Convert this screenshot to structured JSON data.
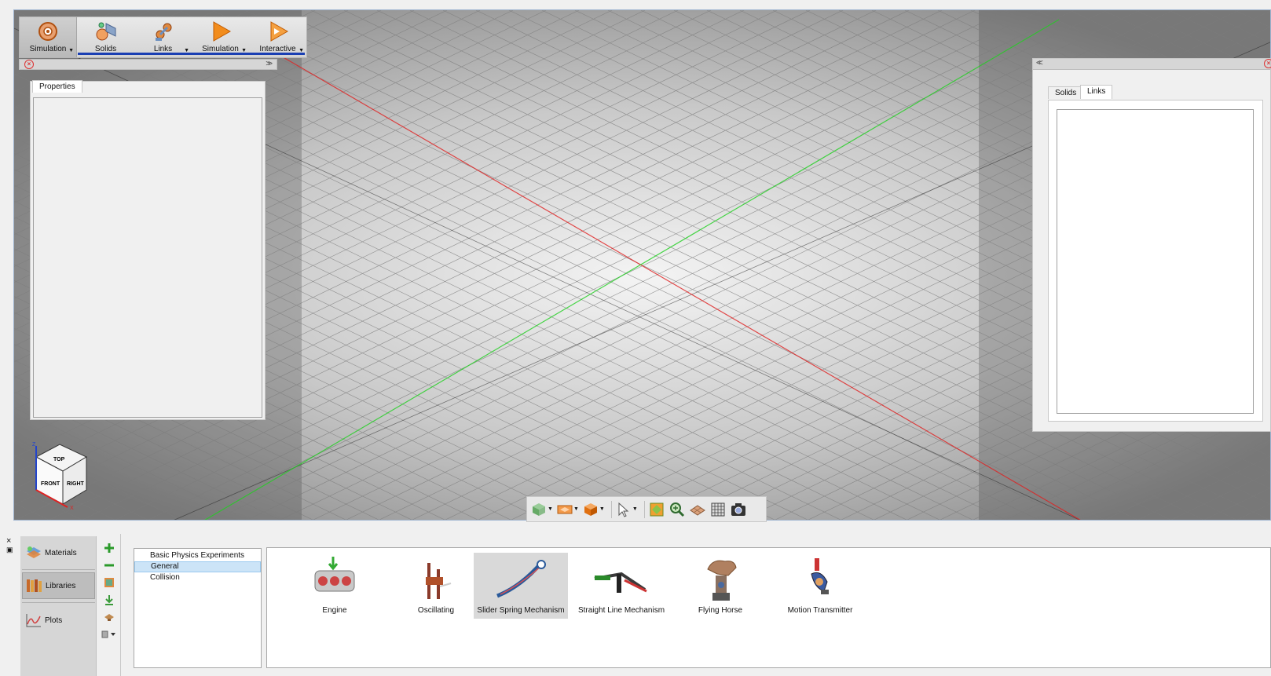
{
  "ribbon": {
    "items": [
      {
        "label": "Simulation",
        "icon": "simulation-gear-icon",
        "has_dropdown": true,
        "active": true
      },
      {
        "label": "Solids",
        "icon": "solids-icon",
        "has_dropdown": false
      },
      {
        "label": "Links",
        "icon": "links-icon",
        "has_dropdown": true
      },
      {
        "label": "Simulation",
        "icon": "play-icon",
        "has_dropdown": true
      },
      {
        "label": "Interactive",
        "icon": "interactive-play-icon",
        "has_dropdown": true
      }
    ]
  },
  "left_panel": {
    "tab": "Properties"
  },
  "right_panel": {
    "tabs": [
      "Solids",
      "Links"
    ],
    "active_tab": "Links"
  },
  "view_toolbar": {
    "icons": [
      "view-cube-icon",
      "plane-icon",
      "solid-box-icon",
      "select-arrow-icon",
      "zoom-fit-icon",
      "zoom-in-icon",
      "floor-grid-icon",
      "grid-icon",
      "camera-icon"
    ]
  },
  "dock": {
    "nav": [
      {
        "label": "Materials",
        "icon": "materials-icon"
      },
      {
        "label": "Libraries",
        "icon": "libraries-icon",
        "active": true
      },
      {
        "label": "Plots",
        "icon": "plots-icon"
      }
    ],
    "tools": [
      "add-icon",
      "remove-icon",
      "import-icon",
      "download-icon",
      "hat-icon",
      "view-mode-icon"
    ],
    "categories": [
      {
        "label": "Basic Physics Experiments"
      },
      {
        "label": "General",
        "selected": true
      },
      {
        "label": "Collision"
      }
    ],
    "examples": [
      {
        "label": "Engine",
        "icon": "engine-icon"
      },
      {
        "label": "Oscillating",
        "icon": "oscillating-icon"
      },
      {
        "label": "Slider Spring Mechanism",
        "icon": "slider-spring-icon",
        "selected": true
      },
      {
        "label": "Straight Line Mechanism",
        "icon": "straight-line-icon"
      },
      {
        "label": "Flying Horse",
        "icon": "flying-horse-icon"
      },
      {
        "label": "Motion Transmitter",
        "icon": "motion-transmitter-icon"
      }
    ]
  },
  "nav_cube": {
    "top": "TOP",
    "front": "FRONT",
    "right": "RIGHT",
    "axis_z": "Z",
    "axis_x": "X"
  },
  "colors": {
    "x_axis": "#e02020",
    "y_axis": "#20d020",
    "accent": "#1a3fb3"
  }
}
